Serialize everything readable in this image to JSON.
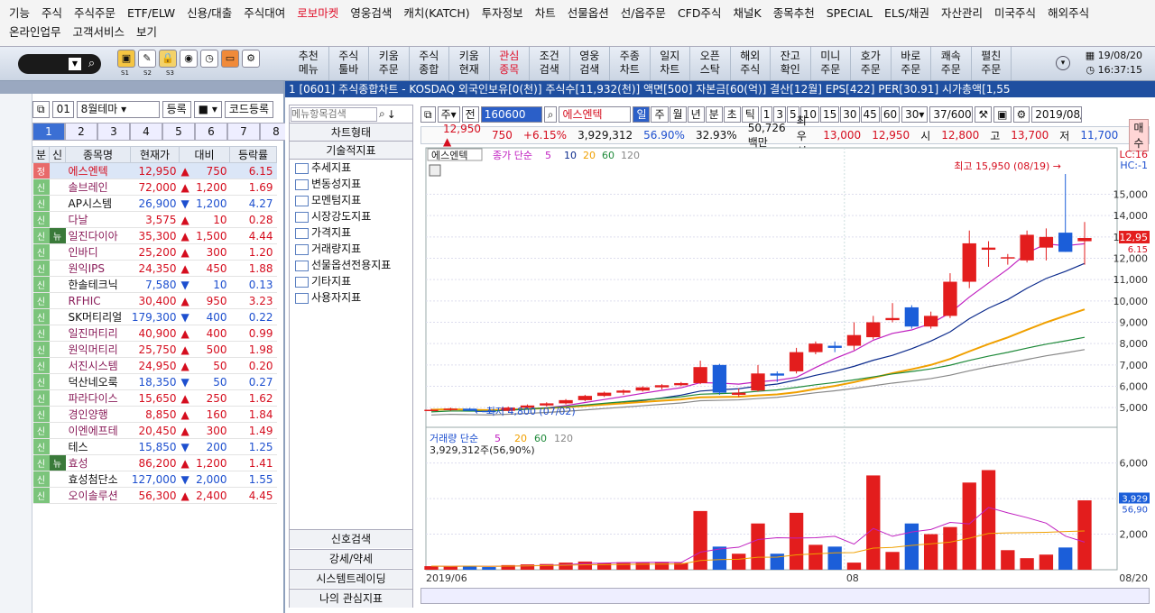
{
  "menu": {
    "row1": [
      "기능",
      "주식",
      "주식주문",
      "ETF/ELW",
      "신용/대출",
      "주식대여",
      "로보마켓",
      "영웅검색",
      "캐치(KATCH)",
      "투자정보",
      "차트",
      "선물옵션",
      "선/옵주문",
      "CFD주식",
      "채널K",
      "종목추천",
      "SPECIAL",
      "ELS/채권",
      "자산관리",
      "미국주식",
      "해외주식"
    ],
    "row2": [
      "온라인업무",
      "고객서비스",
      "보기"
    ],
    "highlight": "로보마켓"
  },
  "toolbar": {
    "icon_subs": [
      "S1",
      "S2",
      "S3"
    ],
    "buttons": [
      {
        "l1": "추천",
        "l2": "메뉴"
      },
      {
        "l1": "주식",
        "l2": "툴바"
      },
      {
        "l1": "키움",
        "l2": "주문"
      },
      {
        "l1": "주식",
        "l2": "종합"
      },
      {
        "l1": "키움",
        "l2": "현재"
      },
      {
        "l1": "관심",
        "l2": "종목",
        "red": true
      },
      {
        "l1": "조건",
        "l2": "검색"
      },
      {
        "l1": "영웅",
        "l2": "검색"
      },
      {
        "l1": "주종",
        "l2": "차트"
      },
      {
        "l1": "일지",
        "l2": "차트"
      },
      {
        "l1": "오픈",
        "l2": "스탁"
      },
      {
        "l1": "해외",
        "l2": "주식"
      },
      {
        "l1": "잔고",
        "l2": "확인"
      },
      {
        "l1": "미니",
        "l2": "주문"
      },
      {
        "l1": "호가",
        "l2": "주문"
      },
      {
        "l1": "바로",
        "l2": "주문"
      },
      {
        "l1": "쾌속",
        "l2": "주문"
      },
      {
        "l1": "펼친",
        "l2": "주문"
      }
    ],
    "date": "19/08/20",
    "time": "16:37:15"
  },
  "left": {
    "group_no": "01",
    "group_name": "8월테마",
    "register": "등록",
    "code_register": "코드등록",
    "tabs": [
      "1",
      "2",
      "3",
      "4",
      "5",
      "6",
      "7",
      "8"
    ],
    "headers": [
      "분",
      "신",
      "종목명",
      "현재가",
      "대비",
      "등락률"
    ],
    "rows": [
      {
        "b": "정",
        "s": "",
        "name": "에스엔텍",
        "price": "12,950",
        "dir": "up",
        "chg": "750",
        "rate": "6.15"
      },
      {
        "b": "신",
        "s": "",
        "name": "솔브레인",
        "price": "72,000",
        "dir": "up",
        "chg": "1,200",
        "rate": "1.69"
      },
      {
        "b": "신",
        "s": "",
        "name": "AP시스템",
        "price": "26,900",
        "dir": "dn",
        "chg": "1,200",
        "rate": "4.27"
      },
      {
        "b": "신",
        "s": "",
        "name": "다날",
        "price": "3,575",
        "dir": "up",
        "chg": "10",
        "rate": "0.28"
      },
      {
        "b": "신",
        "s": "뉴",
        "name": "일진다이아",
        "price": "35,300",
        "dir": "up",
        "chg": "1,500",
        "rate": "4.44"
      },
      {
        "b": "신",
        "s": "",
        "name": "인바디",
        "price": "25,200",
        "dir": "up",
        "chg": "300",
        "rate": "1.20"
      },
      {
        "b": "신",
        "s": "",
        "name": "원익IPS",
        "price": "24,350",
        "dir": "up",
        "chg": "450",
        "rate": "1.88"
      },
      {
        "b": "신",
        "s": "",
        "name": "한솔테크닉",
        "price": "7,580",
        "dir": "dn",
        "chg": "10",
        "rate": "0.13"
      },
      {
        "b": "신",
        "s": "",
        "name": "RFHIC",
        "price": "30,400",
        "dir": "up",
        "chg": "950",
        "rate": "3.23"
      },
      {
        "b": "신",
        "s": "",
        "name": "SK머티리얼",
        "price": "179,300",
        "dir": "dn",
        "chg": "400",
        "rate": "0.22"
      },
      {
        "b": "신",
        "s": "",
        "name": "일진머티리",
        "price": "40,900",
        "dir": "up",
        "chg": "400",
        "rate": "0.99"
      },
      {
        "b": "신",
        "s": "",
        "name": "원익머티리",
        "price": "25,750",
        "dir": "up",
        "chg": "500",
        "rate": "1.98"
      },
      {
        "b": "신",
        "s": "",
        "name": "서진시스템",
        "price": "24,950",
        "dir": "up",
        "chg": "50",
        "rate": "0.20"
      },
      {
        "b": "신",
        "s": "",
        "name": "덕산네오룩",
        "price": "18,350",
        "dir": "dn",
        "chg": "50",
        "rate": "0.27"
      },
      {
        "b": "신",
        "s": "",
        "name": "파라다이스",
        "price": "15,650",
        "dir": "up",
        "chg": "250",
        "rate": "1.62"
      },
      {
        "b": "신",
        "s": "",
        "name": "경인양행",
        "price": "8,850",
        "dir": "up",
        "chg": "160",
        "rate": "1.84"
      },
      {
        "b": "신",
        "s": "",
        "name": "이엔에프테",
        "price": "20,450",
        "dir": "up",
        "chg": "300",
        "rate": "1.49"
      },
      {
        "b": "신",
        "s": "",
        "name": "테스",
        "price": "15,850",
        "dir": "dn",
        "chg": "200",
        "rate": "1.25"
      },
      {
        "b": "신",
        "s": "뉴",
        "name": "효성",
        "price": "86,200",
        "dir": "up",
        "chg": "1,200",
        "rate": "1.41"
      },
      {
        "b": "신",
        "s": "",
        "name": "효성첨단소",
        "price": "127,000",
        "dir": "dn",
        "chg": "2,000",
        "rate": "1.55"
      },
      {
        "b": "신",
        "s": "",
        "name": "오이솔루션",
        "price": "56,300",
        "dir": "up",
        "chg": "2,400",
        "rate": "4.45"
      }
    ]
  },
  "chartwin": {
    "title": "1 [0601] 주식종합차트 - KOSDAQ 외국인보유[0(천)] 주식수[11,932(천)] 액면[500] 자본금[60(억)] 결산[12월] EPS[422] PER[30.91] 시가총액[1,55"
  },
  "mid": {
    "search_placeholder": "메뉴항목검색",
    "chart_type": "차트형태",
    "tech": "기술적지표",
    "items": [
      "추세지표",
      "변동성지표",
      "모멘텀지표",
      "시장강도지표",
      "가격지표",
      "거래량지표",
      "선물옵션전용지표",
      "기타지표",
      "사용자지표"
    ],
    "footer": [
      "신호검색",
      "강세/약세",
      "시스템트레이딩",
      "나의 관심지표"
    ]
  },
  "ctrl": {
    "code": "160600",
    "name": "에스엔텍",
    "periods": [
      "일",
      "주",
      "월",
      "년",
      "분",
      "초",
      "틱"
    ],
    "nums": [
      "1",
      "3",
      "5",
      "10",
      "15",
      "30",
      "45",
      "60"
    ],
    "sel": "30",
    "count": "37/600",
    "date": "2019/08/"
  },
  "quote": {
    "price": "12,950",
    "chg": "750",
    "rate": "+6.15%",
    "volume": "3,929,312",
    "vol_rate": "56.90%",
    "turn": "32.93%",
    "amount": "50,726백만",
    "ask_label": "최우선",
    "ask": "13,000",
    "bid": "12,950",
    "o_label": "시",
    "open": "12,800",
    "h_label": "고",
    "high": "13,700",
    "l_label": "저",
    "low": "11,700",
    "order": "매수"
  },
  "chart_data": {
    "type": "candlestick",
    "title": "에스엔텍",
    "ma_label": "종가 단순",
    "ma_periods": [
      "5",
      "10",
      "20",
      "60",
      "120"
    ],
    "max_label": "최고 15,950 (08/19)",
    "min_label": "최저 4,800 (07/02)",
    "price_ticks": [
      "15,000",
      "14,000",
      "13,000",
      "12,000",
      "11,000",
      "10,000",
      "9,000",
      "8,000",
      "7,000",
      "6,000",
      "5,000"
    ],
    "ylim": [
      4500,
      16500
    ],
    "lc": "LC:16",
    "hc": "HC:-1",
    "last_price": "12,95",
    "last_rate": "6.15",
    "volume_title": "거래량 단순",
    "vol_periods": [
      "5",
      "20",
      "60",
      "120"
    ],
    "vol_value": "3,929,312주(56,90%)",
    "vol_ticks": [
      "6,000",
      "4,000",
      "2,000"
    ],
    "vol_last": "3,929",
    "vol_last_rate": "56,90",
    "x_labels": [
      "2019/06",
      "08",
      "08/20"
    ],
    "candles": [
      [
        4900,
        4950,
        4850,
        4900
      ],
      [
        4900,
        5000,
        4850,
        4950
      ],
      [
        4950,
        4980,
        4850,
        4850
      ],
      [
        4850,
        4900,
        4800,
        4820
      ],
      [
        4850,
        5050,
        4830,
        5000
      ],
      [
        5000,
        5150,
        4950,
        5100
      ],
      [
        5100,
        5250,
        5050,
        5200
      ],
      [
        5200,
        5400,
        5150,
        5350
      ],
      [
        5350,
        5600,
        5300,
        5550
      ],
      [
        5550,
        5750,
        5500,
        5700
      ],
      [
        5700,
        5850,
        5600,
        5800
      ],
      [
        5800,
        6000,
        5750,
        5950
      ],
      [
        5950,
        6100,
        5850,
        6050
      ],
      [
        6050,
        6200,
        6000,
        6150
      ],
      [
        6150,
        7200,
        6100,
        6900
      ],
      [
        7000,
        7050,
        5600,
        5700
      ],
      [
        5600,
        5900,
        5500,
        5700
      ],
      [
        5800,
        7000,
        5750,
        6600
      ],
      [
        6600,
        6700,
        6200,
        6500
      ],
      [
        6700,
        7800,
        6600,
        7600
      ],
      [
        7600,
        8100,
        7500,
        8000
      ],
      [
        7900,
        8100,
        7600,
        7800
      ],
      [
        7900,
        9000,
        7700,
        8400
      ],
      [
        8300,
        9300,
        8200,
        9000
      ],
      [
        9100,
        9900,
        9000,
        9200
      ],
      [
        9700,
        9800,
        8700,
        8800
      ],
      [
        8800,
        9500,
        8700,
        9300
      ],
      [
        9300,
        11300,
        9200,
        10900
      ],
      [
        10900,
        13300,
        10600,
        12700
      ],
      [
        12400,
        12800,
        11600,
        12500
      ],
      [
        12000,
        12200,
        11700,
        12050
      ],
      [
        11900,
        13300,
        11800,
        13100
      ],
      [
        12500,
        13400,
        11900,
        13000
      ],
      [
        13200,
        15950,
        12300,
        12300
      ],
      [
        12800,
        13700,
        11700,
        12950
      ]
    ],
    "volumes": [
      200,
      180,
      220,
      150,
      260,
      300,
      320,
      400,
      460,
      380,
      420,
      400,
      440,
      380,
      3300,
      1300,
      900,
      2600,
      900,
      3200,
      1400,
      1300,
      400,
      5300,
      1000,
      2600,
      2000,
      2400,
      4900,
      5600,
      1100,
      650,
      850,
      1250,
      3900
    ],
    "vol_max": 7500
  },
  "colors": {
    "up": "#e31d1d",
    "down": "#1b5ed9",
    "ma5": "#c020c0",
    "ma10": "#0b2a8c",
    "ma20": "#f0a000",
    "ma60": "#1f8a3a",
    "ma120": "#888888"
  }
}
